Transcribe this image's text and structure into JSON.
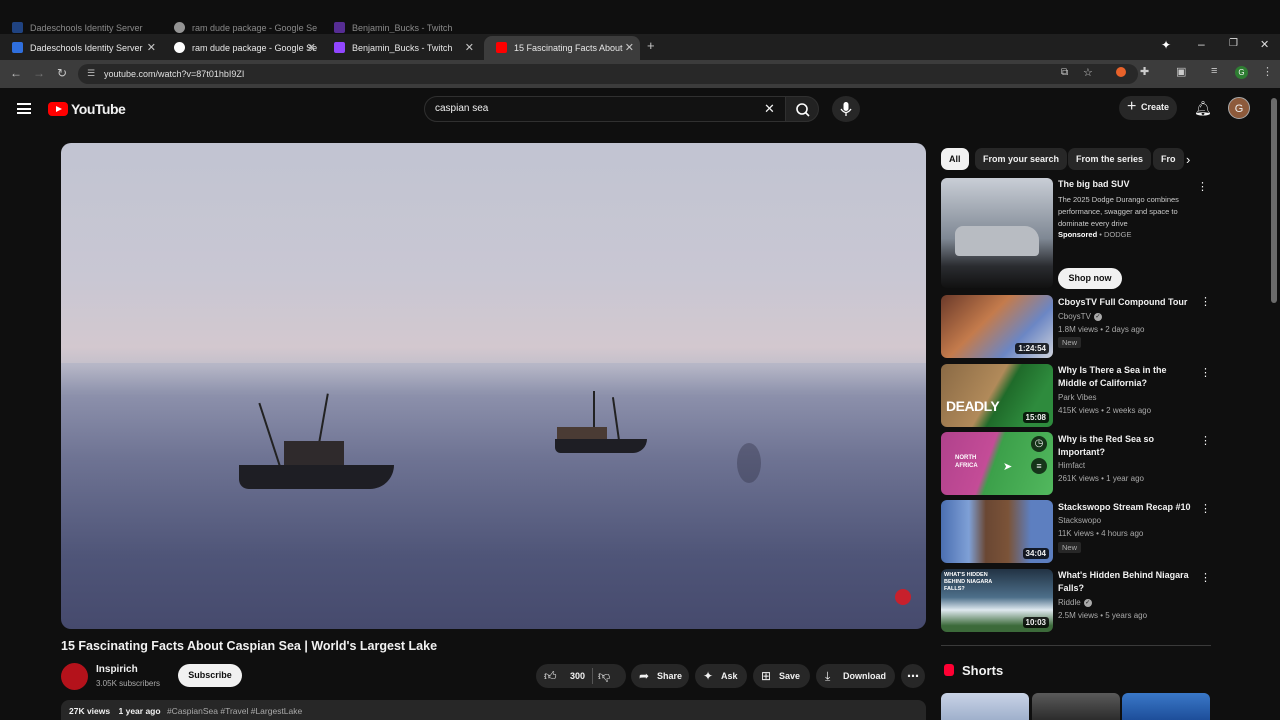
{
  "browser": {
    "tabs": [
      {
        "title": "Dadeschools Identity Server",
        "favicon_color": "#2f6fde"
      },
      {
        "title": "ram dude package - Google Se",
        "favicon_color": "#ffffff"
      },
      {
        "title": "Benjamin_Bucks - Twitch",
        "favicon_color": "#9146ff"
      },
      {
        "title": "15 Fascinating Facts About",
        "favicon_color": "#ff0000"
      }
    ],
    "url": "youtube.com/watch?v=87t01hbI9ZI"
  },
  "youtube": {
    "logo_text": "YouTube",
    "search_query": "caspian sea",
    "create_label": "Create",
    "avatar_letter": "G"
  },
  "video": {
    "title": "15 Fascinating Facts About Caspian Sea | World's Largest Lake",
    "channel": "Inspirich",
    "subscribers": "3.05K subscribers",
    "subscribe_label": "Subscribe",
    "likes": "300",
    "share_label": "Share",
    "ask_label": "Ask",
    "save_label": "Save",
    "download_label": "Download",
    "views": "27K views",
    "age": "1 year ago",
    "hashtags": "#CaspianSea #Travel #LargestLake"
  },
  "chips": [
    "All",
    "From your search",
    "From the series",
    "Fro"
  ],
  "sponsored": {
    "title": "The big bad SUV",
    "description": "The 2025 Dodge Durango combines performance, swagger and space to dominate every drive",
    "sponsored_label": "Sponsored",
    "advertiser": "DODGE",
    "cta": "Shop now"
  },
  "recommendations": [
    {
      "title": "CboysTV Full Compound Tour",
      "channel": "CboysTV",
      "verified": true,
      "meta": "1.8M views • 2 days ago",
      "badge": "New",
      "duration": "1:24:54"
    },
    {
      "title": "Why Is There a Sea in the Middle of California?",
      "channel": "Park Vibes",
      "verified": false,
      "meta": "415K views • 2 weeks ago",
      "badge": "",
      "duration": "15:08",
      "thumb_text": "DEADLY"
    },
    {
      "title": "Why is the Red Sea so Important?",
      "channel": "Himfact",
      "verified": false,
      "meta": "261K views • 1 year ago",
      "badge": "",
      "duration": "",
      "thumb_text": "NORTH AFRICA"
    },
    {
      "title": "Stackswopo Stream Recap #10",
      "channel": "Stackswopo",
      "verified": false,
      "meta": "11K views • 4 hours ago",
      "badge": "New",
      "duration": "34:04"
    },
    {
      "title": "What's Hidden Behind Niagara Falls?",
      "channel": "Riddle",
      "verified": true,
      "meta": "2.5M views • 5 years ago",
      "badge": "",
      "duration": "10:03",
      "thumb_text": "WHAT'S HIDDEN BEHIND NIAGARA FALLS?"
    }
  ],
  "shorts_label": "Shorts"
}
